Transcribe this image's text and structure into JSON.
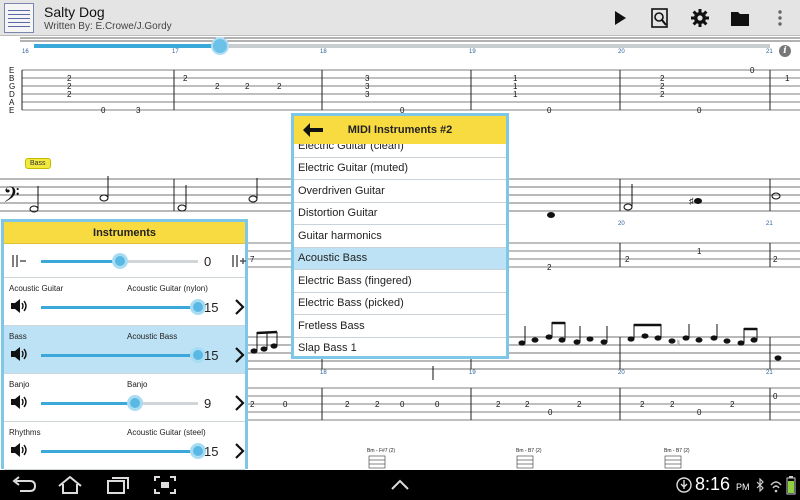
{
  "header": {
    "title": "Salty Dog",
    "subtitle": "Written By: E.Crowe/J.Gordy"
  },
  "playback": {
    "progress": 0.24,
    "tab_strings": [
      "E",
      "B",
      "G",
      "D",
      "A",
      "E"
    ]
  },
  "score": {
    "bass_label": "Bass",
    "bar_numbers": [
      "16",
      "17",
      "18",
      "19",
      "20",
      "21"
    ],
    "chord_labels": [
      "Bm - F#7 (2)",
      "Bm - B7 (2)",
      "Bm - B7 (2)"
    ]
  },
  "instruments_panel": {
    "title": "Instruments",
    "master_value": "0",
    "master_level": 0.5,
    "rows": [
      {
        "name": "Acoustic Guitar",
        "program": "Acoustic Guitar (nylon)",
        "volume": "15",
        "level": 1.0,
        "selected": false
      },
      {
        "name": "Bass",
        "program": "Acoustic Bass",
        "volume": "15",
        "level": 1.0,
        "selected": true
      },
      {
        "name": "Banjo",
        "program": "Banjo",
        "volume": "9",
        "level": 0.6,
        "selected": false
      },
      {
        "name": "Rhythms",
        "program": "Acoustic Guitar (steel)",
        "volume": "15",
        "level": 1.0,
        "selected": false
      }
    ]
  },
  "midi_panel": {
    "title": "MIDI Instruments #2",
    "items": [
      "Electric Guitar (clean)",
      "Electric Guitar (muted)",
      "Overdriven Guitar",
      "Distortion Guitar",
      "Guitar harmonics",
      "Acoustic Bass",
      "Electric Bass (fingered)",
      "Electric Bass (picked)",
      "Fretless Bass",
      "Slap Bass 1"
    ],
    "selected": "Acoustic Bass"
  },
  "status_bar": {
    "time": "8:16",
    "ampm": "PM"
  },
  "colors": {
    "accent": "#3aa8d8",
    "panel_header": "#f8da41",
    "panel_border": "#7fc7e6",
    "selected_row": "#bde2f5"
  }
}
